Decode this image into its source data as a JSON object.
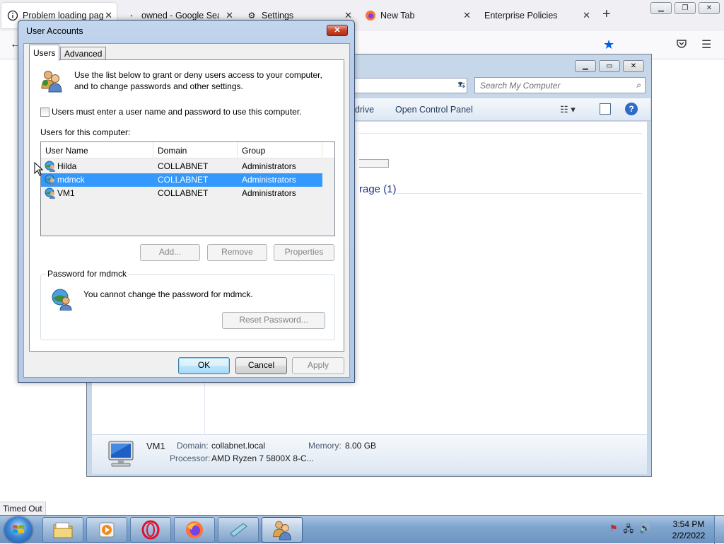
{
  "browser": {
    "tabs": [
      {
        "title": "Problem loading page",
        "active": true
      },
      {
        "title": "owned - Google Search",
        "active": false
      },
      {
        "title": "Settings",
        "active": false
      },
      {
        "title": "New Tab",
        "active": false
      },
      {
        "title": "Enterprise Policies",
        "active": false
      }
    ],
    "new_tab": "+",
    "status_text": "Timed Out"
  },
  "explorer": {
    "search_placeholder": "Search My Computer",
    "toolbar": {
      "map_drive": "drive",
      "open_control_panel": "Open Control Panel"
    },
    "group_header": "rage (1)",
    "details": {
      "computer_name": "VM1",
      "domain_label": "Domain:",
      "domain_value": "collabnet.local",
      "memory_label": "Memory:",
      "memory_value": "8.00 GB",
      "processor_label": "Processor:",
      "processor_value": "AMD Ryzen 7 5800X 8-C..."
    }
  },
  "dialog": {
    "title": "User Accounts",
    "close_label": "✕",
    "tabs": [
      "Users",
      "Advanced"
    ],
    "intro": "Use the list below to grant or deny users access to your computer, and to change passwords and other settings.",
    "must_login_checkbox": {
      "label": "Users must enter a user name and password to use this computer.",
      "checked": false
    },
    "users_label": "Users for this computer:",
    "columns": [
      "User Name",
      "Domain",
      "Group"
    ],
    "users": [
      {
        "name": "Hilda",
        "domain": "COLLABNET",
        "group": "Administrators",
        "selected": false
      },
      {
        "name": "mdmck",
        "domain": "COLLABNET",
        "group": "Administrators",
        "selected": true
      },
      {
        "name": "VM1",
        "domain": "COLLABNET",
        "group": "Administrators",
        "selected": false
      }
    ],
    "buttons": {
      "add": "Add...",
      "remove": "Remove",
      "properties": "Properties"
    },
    "password_group": {
      "title": "Password for mdmck",
      "message": "You cannot change the password for mdmck.",
      "reset_button": "Reset Password..."
    },
    "footer": {
      "ok": "OK",
      "cancel": "Cancel",
      "apply": "Apply"
    }
  },
  "taskbar": {
    "clock_time": "3:54 PM",
    "clock_date": "2/2/2022"
  },
  "colors": {
    "selection": "#3399ff",
    "firefox_accent": "#0060df",
    "link_blue": "#1e3287"
  }
}
